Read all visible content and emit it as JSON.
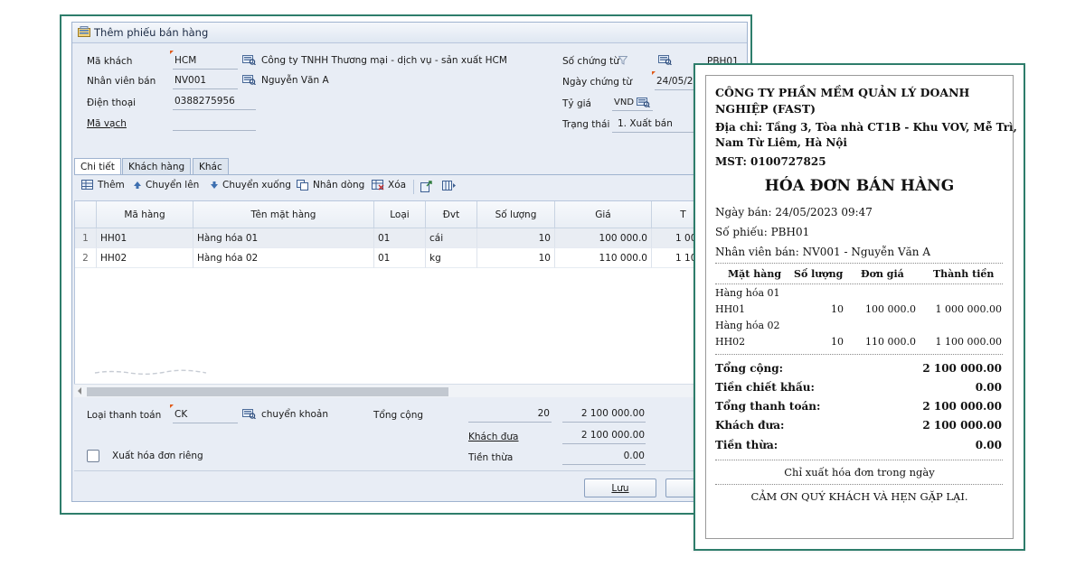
{
  "window": {
    "title": "Thêm phiếu bán hàng"
  },
  "header": {
    "ma_khach_label": "Mã khách",
    "ma_khach_value": "HCM",
    "ma_khach_name": "Công ty TNHH Thương mại - dịch vụ - sản xuất HCM",
    "nhan_vien_label": "Nhân viên bán",
    "nhan_vien_value": "NV001",
    "nhan_vien_name": "Nguyễn Văn A",
    "dien_thoai_label": "Điện thoại",
    "dien_thoai_value": "0388275956",
    "ma_vach_label": "Mã vạch",
    "so_chung_tu_label": "Số chứng từ",
    "so_chung_tu_value": "PBH01",
    "ngay_chung_tu_label": "Ngày chứng từ",
    "ngay_chung_tu_value": "24/05/2",
    "ty_gia_label": "Tỷ giá",
    "ty_gia_value": "VND",
    "trang_thai_label": "Trạng thái",
    "trang_thai_value": "1. Xuất bán"
  },
  "tabs": [
    {
      "label": "Chi tiết"
    },
    {
      "label": "Khách hàng"
    },
    {
      "label": "Khác"
    }
  ],
  "toolbar": {
    "them": "Thêm",
    "chuyen_len": "Chuyển lên",
    "chuyen_xuong": "Chuyển xuống",
    "nhan_dong": "Nhân dòng",
    "xoa": "Xóa"
  },
  "grid": {
    "columns": [
      "Mã hàng",
      "Tên mặt hàng",
      "Loại",
      "Đvt",
      "Số lượng",
      "Giá",
      "T"
    ],
    "rows": [
      {
        "stt": "1",
        "ma": "HH01",
        "ten": "Hàng hóa 01",
        "loai": "01",
        "dvt": "cái",
        "so_luong": "10",
        "gia": "100 000.0",
        "tien": "1 00"
      },
      {
        "stt": "2",
        "ma": "HH02",
        "ten": "Hàng hóa 02",
        "loai": "01",
        "dvt": "kg",
        "so_luong": "10",
        "gia": "110 000.0",
        "tien": "1 10"
      }
    ]
  },
  "footer": {
    "loai_tt_label": "Loại thanh toán",
    "loai_tt_value": "CK",
    "loai_tt_name": "chuyển khoản",
    "tong_cong_label": "Tổng cộng",
    "tong_cong_qty": "20",
    "tong_cong_amount": "2 100 000.00",
    "khach_dua_label": "Khách đưa",
    "khach_dua_value": "2 100 000.00",
    "tien_thua_label": "Tiền thừa",
    "tien_thua_value": "0.00",
    "xuat_hd_label": "Xuất hóa đơn riêng",
    "luu_button": "Lưu"
  },
  "receipt": {
    "company_line1": "CÔNG TY PHẦN MỀM QUẢN LÝ DOANH",
    "company_line2": "NGHIỆP (FAST)",
    "address_line1": "Địa chỉ: Tầng 3, Tòa nhà CT1B - Khu VOV, Mễ Trì,",
    "address_line2": "Nam Từ Liêm, Hà Nội",
    "mst": "MST: 0100727825",
    "title": "HÓA ĐƠN BÁN HÀNG",
    "ngay_ban": "Ngày bán: 24/05/2023 09:47",
    "so_phieu": "Số phiếu: PBH01",
    "nhan_vien": "Nhân viên bán: NV001 - Nguyễn Văn A",
    "col_mat_hang": "Mặt hàng",
    "col_so_luong": "Số lượng",
    "col_don_gia": "Đơn giá",
    "col_thanh_tien": "Thành tiền",
    "items": [
      {
        "name": "Hàng hóa 01",
        "code": "HH01",
        "qty": "10",
        "price": "100 000.0",
        "amount": "1 000 000.00"
      },
      {
        "name": "Hàng hóa 02",
        "code": "HH02",
        "qty": "10",
        "price": "110 000.0",
        "amount": "1 100 000.00"
      }
    ],
    "tong_cong_label": "Tổng cộng:",
    "tong_cong_value": "2 100 000.00",
    "chiet_khau_label": "Tiền chiết khấu:",
    "chiet_khau_value": "0.00",
    "tong_tt_label": "Tổng thanh toán:",
    "tong_tt_value": "2 100 000.00",
    "khach_dua_label": "Khách đưa:",
    "khach_dua_value": "2 100 000.00",
    "tien_thua_label": "Tiền thừa:",
    "tien_thua_value": "0.00",
    "note": "Chỉ xuất hóa đơn trong ngày",
    "thanks": "CẢM ƠN QUÝ KHÁCH VÀ HẸN GẶP LẠI."
  }
}
